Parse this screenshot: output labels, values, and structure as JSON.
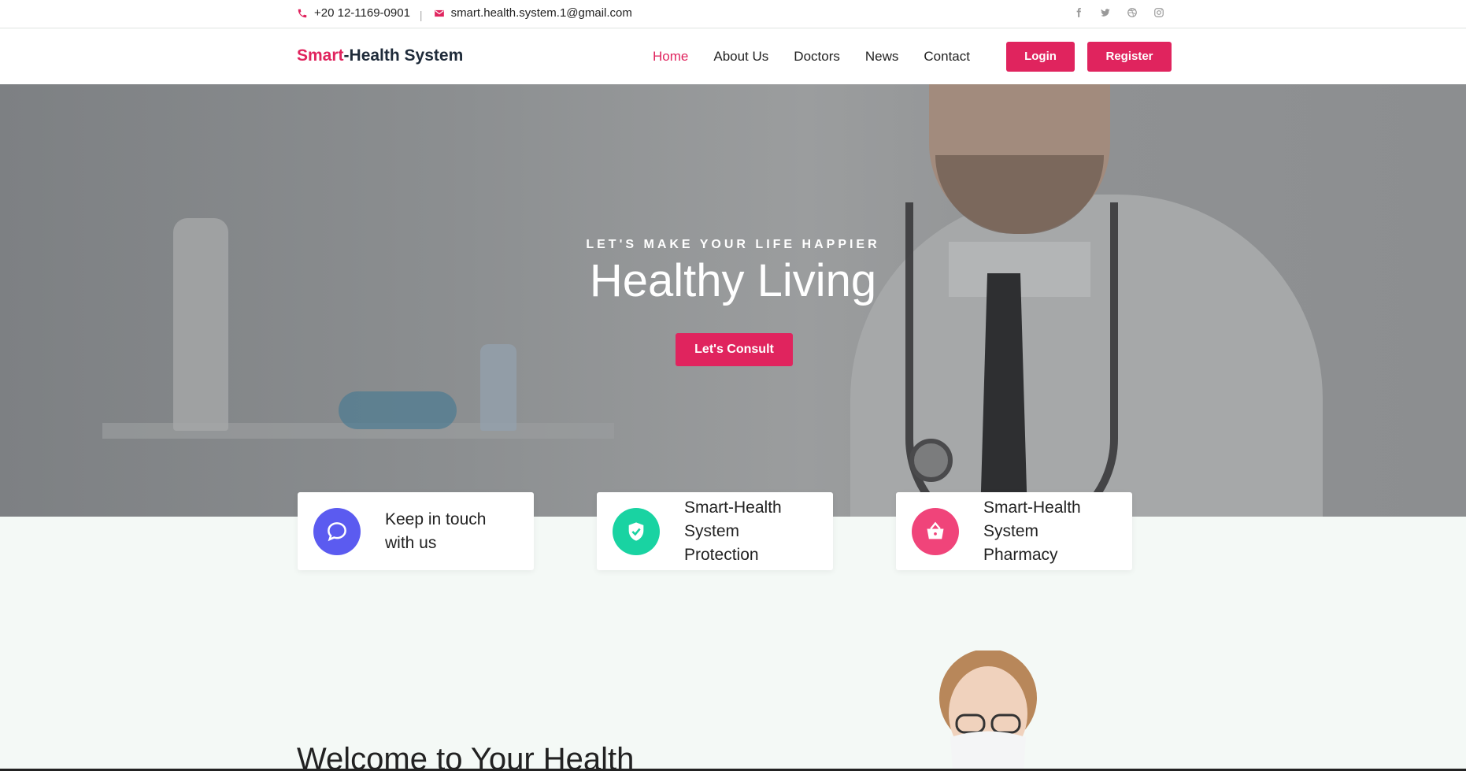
{
  "topbar": {
    "phone": "+20 12-1169-0901",
    "email": "smart.health.system.1@gmail.com",
    "separator": "|",
    "social": [
      "facebook-icon",
      "twitter-icon",
      "dribbble-icon",
      "instagram-icon"
    ]
  },
  "header": {
    "logo_accent": "Smart",
    "logo_rest": "-Health System",
    "nav": [
      "Home",
      "About Us",
      "Doctors",
      "News",
      "Contact"
    ],
    "active_nav": "Home",
    "login_label": "Login",
    "register_label": "Register"
  },
  "hero": {
    "tagline": "LET'S MAKE YOUR LIFE HAPPIER",
    "title": "Healthy Living",
    "cta_label": "Let's Consult"
  },
  "features": [
    {
      "label": "Keep in touch with us",
      "icon": "chat-icon",
      "color": "#5b5bf0"
    },
    {
      "label": "Smart-Health System Protection",
      "icon": "shield-icon",
      "color": "#19d3a2"
    },
    {
      "label": "Smart-Health System Pharmacy",
      "icon": "basket-icon",
      "color": "#f0447a"
    }
  ],
  "welcome": {
    "title": "Welcome to Your Health"
  },
  "colors": {
    "accent": "#e0245e",
    "dark": "#1f2b3a"
  }
}
